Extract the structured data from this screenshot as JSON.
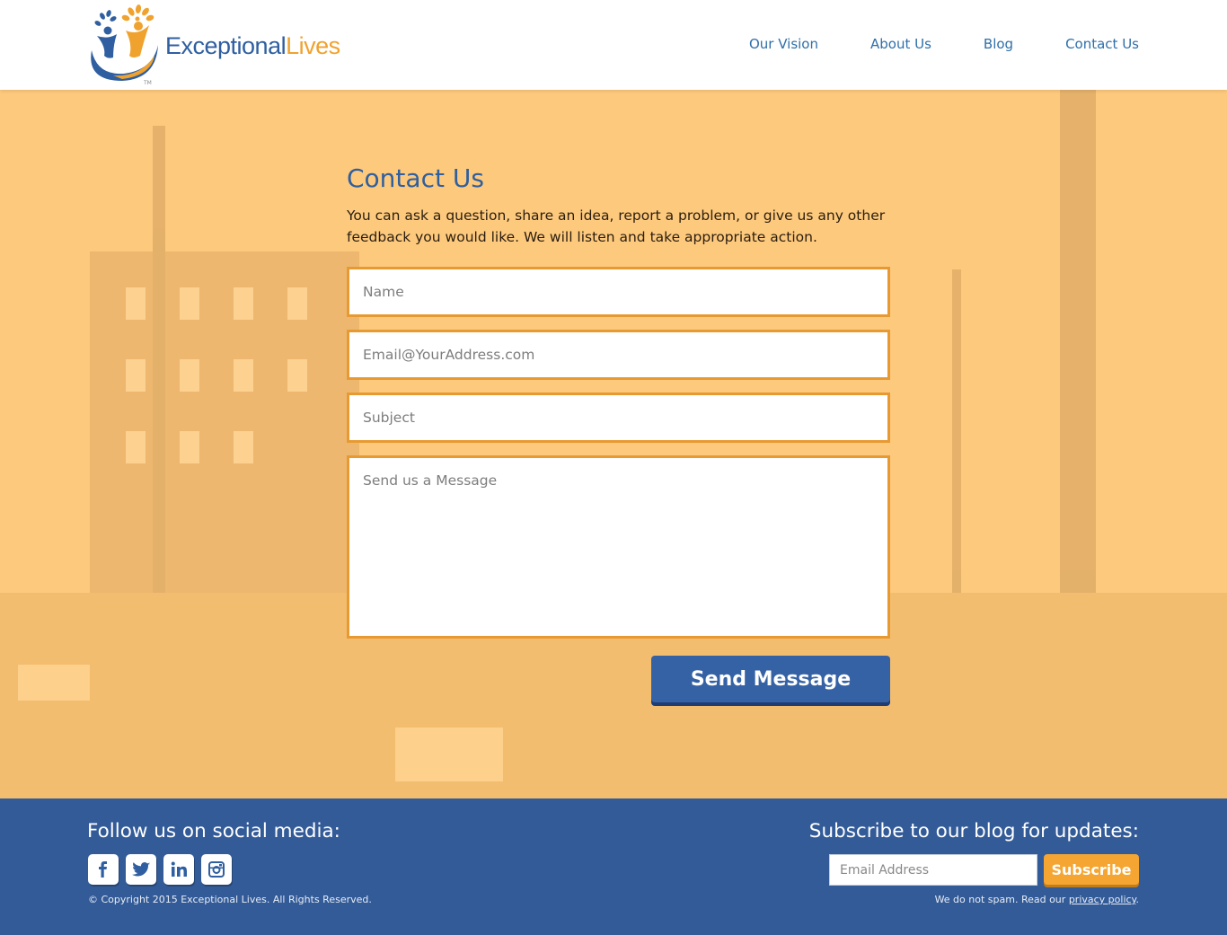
{
  "brand": {
    "name_part1": "Exceptional",
    "name_part2": "Lives",
    "trademark": "TM",
    "color_blue": "#2f5fa0",
    "color_orange": "#f0a22e"
  },
  "nav": {
    "items": [
      {
        "label": "Our Vision"
      },
      {
        "label": "About Us"
      },
      {
        "label": "Blog"
      },
      {
        "label": "Contact Us"
      }
    ]
  },
  "contact": {
    "title": "Contact Us",
    "description": "You can ask a question, share an idea, report a problem, or give us any other feedback you would like. We will listen and take appropriate action.",
    "name_placeholder": "Name",
    "email_placeholder": "Email@YourAddress.com",
    "subject_placeholder": "Subject",
    "message_placeholder": "Send us a Message",
    "send_label": "Send Message",
    "background_color": "#fdc97c",
    "field_border_color": "#e89a32",
    "button_color": "#3561a5"
  },
  "footer": {
    "follow_title": "Follow us on social media:",
    "social_icons": [
      "facebook-icon",
      "twitter-icon",
      "linkedin-icon",
      "instagram-icon"
    ],
    "copyright": "© Copyright 2015 Exceptional Lives. All Rights Reserved.",
    "subscribe_title": "Subscribe to our blog for updates:",
    "email_placeholder": "Email Address",
    "subscribe_label": "Subscribe",
    "spam_text": "We do not spam. Read our ",
    "privacy_link": "privacy policy",
    "spam_end": ".",
    "background_color": "#335b98",
    "subscribe_color": "#f5a531"
  }
}
